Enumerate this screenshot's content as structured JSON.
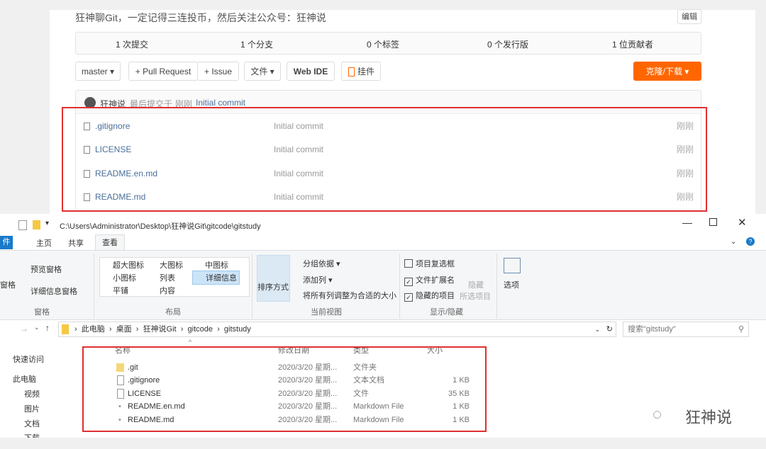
{
  "repo": {
    "description": "狂神聊Git，一定记得三连投币，然后关注公众号：狂神说",
    "edit": "编辑",
    "stats": [
      "1 次提交",
      "1 个分支",
      "0 个标签",
      "0 个发行版",
      "1 位贡献者"
    ],
    "branch": "master ▾",
    "pull_request": "+ Pull Request",
    "issue": "+ Issue",
    "file": "文件 ▾",
    "web_ide": "Web IDE",
    "widget": "挂件",
    "clone": "克隆/下载 ▾",
    "last_commit": {
      "author": "狂神说",
      "text": "最后提交于",
      "time": "刚刚",
      "message": "Initial commit"
    },
    "files": [
      {
        "name": ".gitignore",
        "commit": "Initial commit",
        "time": "刚刚"
      },
      {
        "name": "LICENSE",
        "commit": "Initial commit",
        "time": "刚刚"
      },
      {
        "name": "README.en.md",
        "commit": "Initial commit",
        "time": "刚刚"
      },
      {
        "name": "README.md",
        "commit": "Initial commit",
        "time": "刚刚"
      }
    ]
  },
  "explorer": {
    "path": "C:\\Users\\Administrator\\Desktop\\狂神说Git\\gitcode\\gitstudy",
    "tabs": [
      "件",
      "主页",
      "共享",
      "查看"
    ],
    "ribbon": {
      "preview_pane": "预览窗格",
      "details_pane": "详细信息窗格",
      "pane": "窗格",
      "pane_group": "窗格",
      "layouts": [
        "超大图标",
        "大图标",
        "中图标",
        "小图标",
        "列表",
        "详细信息",
        "平铺",
        "内容"
      ],
      "layout_group": "布局",
      "sort": "排序方式",
      "group_by": "分组依据 ▾",
      "add_col": "添加列 ▾",
      "fit_cols": "将所有列调整为合适的大小",
      "view_group": "当前视图",
      "item_checkbox": "项目复选框",
      "extensions": "文件扩展名",
      "hidden_items": "隐藏的项目",
      "hide": "隐藏",
      "selected": "所选项目",
      "show_group": "显示/隐藏",
      "options": "选项"
    },
    "breadcrumb": [
      "此电脑",
      "桌面",
      "狂神说Git",
      "gitcode",
      "gitstudy"
    ],
    "search_placeholder": "搜索\"gitstudy\"",
    "sidebar": [
      "快速访问",
      "此电脑",
      "视频",
      "图片",
      "文档",
      "下载"
    ],
    "columns": [
      "名称",
      "修改日期",
      "类型",
      "大小"
    ],
    "files": [
      {
        "name": ".git",
        "date": "2020/3/20 星期...",
        "type": "文件夹",
        "size": ""
      },
      {
        "name": ".gitignore",
        "date": "2020/3/20 星期...",
        "type": "文本文档",
        "size": "1 KB"
      },
      {
        "name": "LICENSE",
        "date": "2020/3/20 星期...",
        "type": "文件",
        "size": "35 KB"
      },
      {
        "name": "README.en.md",
        "date": "2020/3/20 星期...",
        "type": "Markdown File",
        "size": "1 KB"
      },
      {
        "name": "README.md",
        "date": "2020/3/20 星期...",
        "type": "Markdown File",
        "size": "1 KB"
      }
    ]
  },
  "watermark": "狂神说"
}
